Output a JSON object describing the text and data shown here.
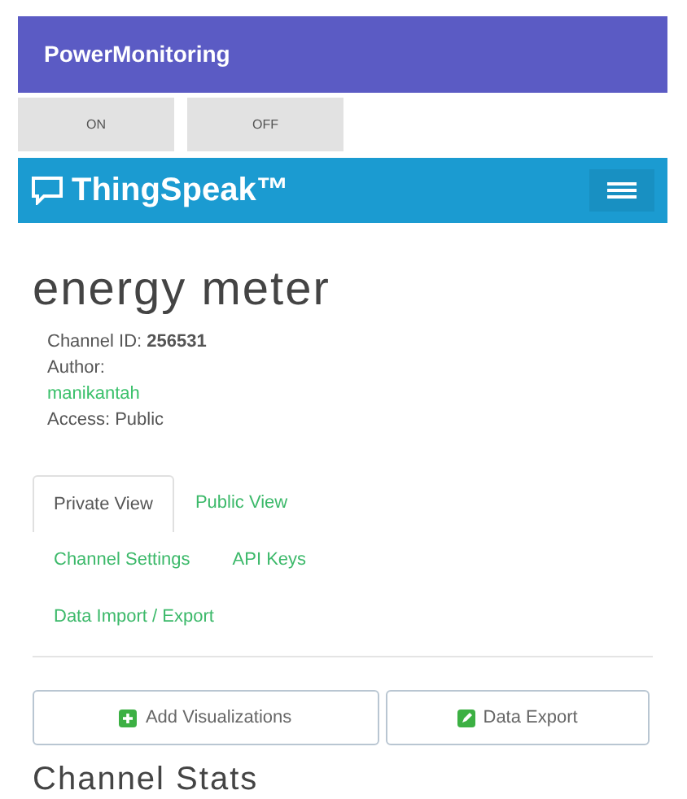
{
  "app_bar": {
    "title": "PowerMonitoring"
  },
  "buttons": [
    {
      "label": "ON"
    },
    {
      "label": "OFF"
    }
  ],
  "site_header": {
    "logo": "ThingSpeak™"
  },
  "channel": {
    "title": "energy meter",
    "id_line": "Channel ID: **256531**",
    "author_label": "Author:",
    "author": "manikantah",
    "access": "Access: Public"
  },
  "tabs": [
    {
      "label": "Private View",
      "selected": true
    },
    {
      "label": "Public View",
      "selected": false
    },
    {
      "label": "Channel Settings",
      "selected": false
    },
    {
      "label": "API Keys",
      "selected": false
    },
    {
      "label": "Data Import / Export",
      "selected": false
    }
  ],
  "actions": [
    {
      "label": "Add Visualizations",
      "kind": "add"
    },
    {
      "label": "Data Export",
      "kind": "export"
    }
  ],
  "section_title": "Channel Stats"
}
